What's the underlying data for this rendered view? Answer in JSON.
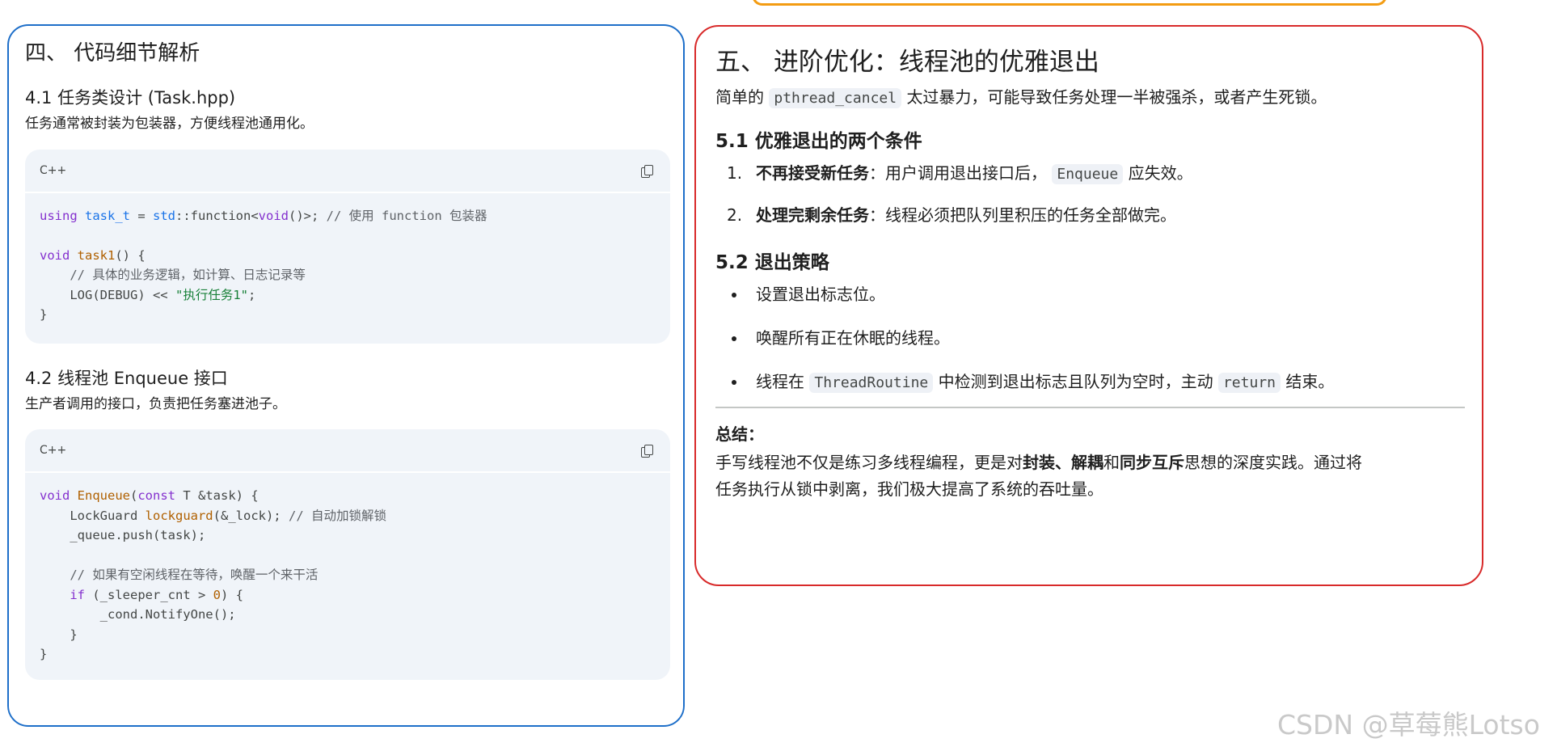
{
  "left": {
    "title": "四、 代码细节解析",
    "s41": {
      "heading": "4.1 任务类设计 (Task.hpp)",
      "desc": "任务通常被封装为包装器，方便线程池通用化。",
      "code_lang": "C++"
    },
    "s42": {
      "heading": "4.2 线程池 Enqueue 接口",
      "desc": "生产者调用的接口，负责把任务塞进池子。",
      "code_lang": "C++"
    }
  },
  "right": {
    "title": "五、 进阶优化：线程池的优雅退出",
    "intro_before": "简单的",
    "intro_code": "pthread_cancel",
    "intro_after": "太过暴力，可能导致任务处理一半被强杀，或者产生死锁。",
    "s51": {
      "heading": "5.1 优雅退出的两个条件",
      "items": [
        {
          "num": "1.",
          "bold": "不再接受新任务",
          "text_before": "：用户调用退出接口后，",
          "code": "Enqueue",
          "text_after": "应失效。"
        },
        {
          "num": "2.",
          "bold": "处理完剩余任务",
          "text_before": "：线程必须把队列里积压的任务全部做完。"
        }
      ]
    },
    "s52": {
      "heading": "5.2 退出策略",
      "items": [
        {
          "text": "设置退出标志位。"
        },
        {
          "text": "唤醒所有正在休眠的线程。"
        },
        {
          "text_before": "线程在",
          "code": "ThreadRoutine",
          "text_mid": "中检测到退出标志且队列为空时，主动",
          "code2": "return",
          "text_after": "结束。"
        }
      ]
    },
    "summary": {
      "title": "总结：",
      "p1": "手写线程池不仅是练习多线程编程，更是对",
      "b1": "封装",
      "sep1": "、",
      "b2": "解耦",
      "and": "和",
      "b3": "同步互斥",
      "p2": "思想的深度实践。通过将",
      "line2": "任务执行从锁中剥离，我们极大提高了系统的吞吐量。"
    }
  },
  "watermark": "CSDN @草莓熊Lotso"
}
